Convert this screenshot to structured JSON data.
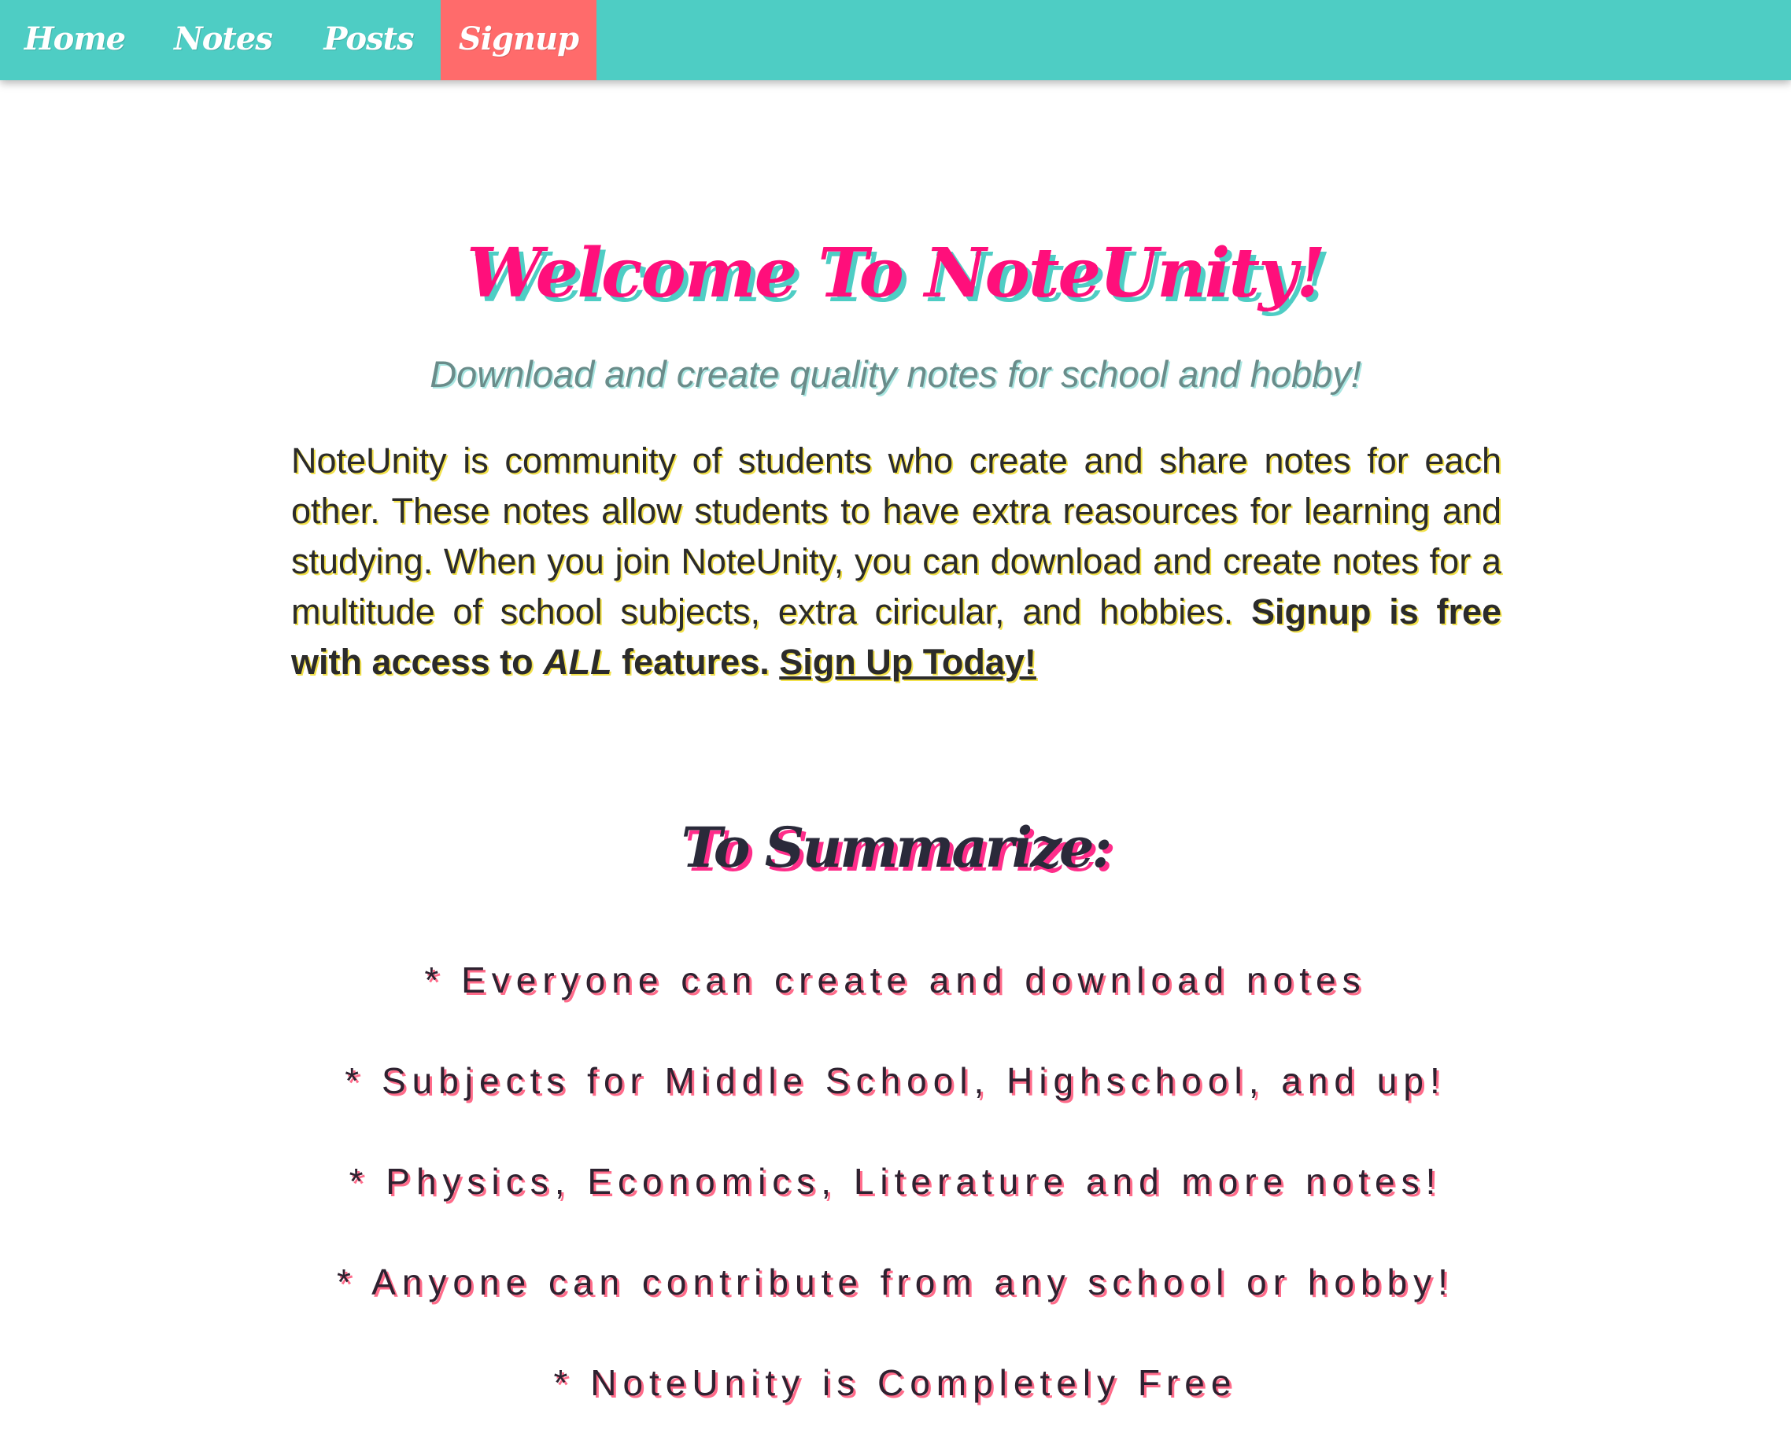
{
  "nav": {
    "items": [
      {
        "label": "Home",
        "active": false
      },
      {
        "label": "Notes",
        "active": false
      },
      {
        "label": "Posts",
        "active": false
      },
      {
        "label": "Signup",
        "active": true
      }
    ]
  },
  "hero": {
    "title": "Welcome To NoteUnity!",
    "subtitle": "Download and create quality notes for school and hobby!"
  },
  "intro": {
    "text": "NoteUnity is community of students who create and share notes for each other. These notes allow students to have extra reasources for learning and studying. When you join NoteUnity, you can download and create notes for a multitude of school subjects, extra ciricular, and hobbies.",
    "bold_lead": "Signup is free with access to",
    "bold_emph": "ALL",
    "bold_tail": "features.",
    "link": "Sign Up Today!"
  },
  "summary": {
    "heading": "To Summarize:",
    "items": [
      "* Everyone can create and download notes",
      "* Subjects for Middle School, Highschool, and up!",
      "* Physics, Economics, Literature and more notes!",
      "* Anyone can contribute from any school or hobby!",
      "* NoteUnity is Completely Free"
    ]
  },
  "colors": {
    "nav_bg": "#4ecdc4",
    "nav_active_bg": "#ff6b6b",
    "title": "#ff0f7b",
    "title_shadow": "#4ecdc4",
    "intro_shadow": "#f2e14a",
    "summary_shadow": "#ff6b8a"
  }
}
